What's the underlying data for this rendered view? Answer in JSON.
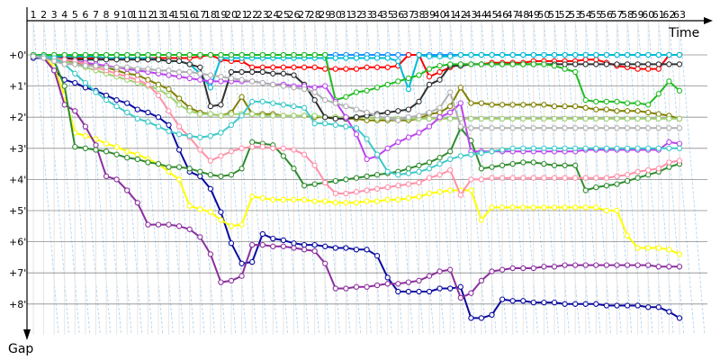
{
  "chart_data": {
    "type": "line",
    "title": "",
    "xlabel": "Time",
    "ylabel": "Gap",
    "x_ticks": [
      "1",
      "2",
      "3",
      "4",
      "5",
      "6",
      "7",
      "8",
      "9",
      "10",
      "11",
      "12",
      "13",
      "14",
      "15",
      "16",
      "17",
      "18",
      "19",
      "20",
      "21",
      "22",
      "23",
      "24",
      "25",
      "26",
      "27",
      "28",
      "29",
      "30",
      "31",
      "32",
      "33",
      "34",
      "35",
      "36",
      "37",
      "38",
      "39",
      "40",
      "41",
      "42",
      "43",
      "44",
      "45",
      "46",
      "47",
      "48",
      "49",
      "50",
      "51",
      "52",
      "53",
      "54",
      "55",
      "56",
      "57",
      "58",
      "59",
      "60",
      "61",
      "62",
      "63"
    ],
    "y_ticks": [
      "+0'",
      "+1'",
      "+2'",
      "+3'",
      "+4'",
      "+5'",
      "+6'",
      "+7'",
      "+8'"
    ],
    "y_range_minutes": [
      0,
      8.9
    ],
    "grid": true,
    "legend": "none",
    "series": [
      {
        "color": "#1e90ff",
        "values": [
          0,
          0,
          0,
          0,
          0,
          0,
          0,
          0,
          0,
          0,
          0,
          0,
          0,
          0,
          0,
          0,
          0,
          0,
          0,
          0,
          0,
          0,
          0,
          0,
          0,
          0,
          0,
          0,
          0,
          0,
          0,
          0,
          0,
          0,
          0,
          0,
          0,
          0,
          0,
          0,
          0,
          0,
          0,
          0,
          0,
          0,
          0,
          0,
          0,
          0,
          0,
          0,
          0,
          0,
          0,
          0,
          0,
          0,
          0,
          0,
          0,
          0,
          0
        ]
      },
      {
        "color": "#ff0000",
        "values": [
          0.05,
          0.05,
          0.05,
          0.1,
          0.1,
          0.1,
          0.1,
          0.1,
          0.1,
          0.1,
          0.1,
          0.1,
          0.1,
          0.1,
          0.1,
          0.1,
          0.05,
          0,
          0.15,
          0.2,
          0.2,
          0.4,
          0.4,
          0.4,
          0.4,
          0.4,
          0.4,
          0.4,
          0.45,
          0.45,
          0.45,
          0.45,
          0.4,
          0.4,
          0.4,
          0.35,
          0,
          0,
          0.7,
          0.55,
          0.4,
          0.3,
          0.3,
          0.3,
          0.25,
          0.25,
          0.25,
          0.25,
          0.2,
          0.2,
          0.2,
          0.2,
          0.2,
          0.15,
          0.15,
          0.25,
          0.35,
          0.4,
          0.45,
          0.45,
          0.45,
          0,
          0
        ]
      },
      {
        "color": "#00bcd4",
        "values": [
          0.05,
          0.05,
          0.05,
          0.05,
          0.05,
          0.05,
          0.05,
          0.1,
          0.1,
          0.1,
          0.1,
          0.1,
          0.15,
          0.2,
          0.2,
          0.3,
          0.6,
          1.05,
          0.1,
          0.1,
          0.1,
          0.1,
          0.1,
          0.1,
          0.1,
          0.1,
          0.1,
          0.1,
          0.1,
          0.1,
          0.1,
          0.1,
          0.1,
          0.1,
          0.1,
          0.2,
          1.1,
          0,
          0.05,
          0.05,
          0.05,
          0,
          0,
          0,
          0,
          0,
          0,
          0,
          0,
          0,
          0,
          0,
          0,
          0,
          0,
          0,
          0,
          0,
          0,
          0,
          0,
          0,
          0
        ]
      },
      {
        "color": "#0a0aa0",
        "values": [
          0.1,
          0.1,
          0.5,
          0.8,
          0.9,
          1.05,
          1.15,
          1.3,
          1.45,
          1.55,
          1.75,
          1.85,
          2.0,
          2.25,
          3.05,
          3.75,
          3.9,
          4.3,
          5.05,
          6.05,
          6.7,
          6.65,
          5.75,
          5.9,
          5.95,
          6.05,
          6.1,
          6.1,
          6.15,
          6.2,
          6.2,
          6.25,
          6.25,
          6.45,
          7.15,
          7.6,
          7.6,
          7.6,
          7.6,
          7.5,
          7.5,
          7.45,
          8.45,
          8.45,
          8.35,
          7.85,
          7.9,
          7.9,
          7.95,
          7.95,
          7.95,
          8.0,
          8.0,
          8.0,
          8.0,
          8.05,
          8.05,
          8.05,
          8.05,
          8.1,
          8.1,
          8.25,
          8.45
        ]
      },
      {
        "color": "#808000",
        "values": [
          0.05,
          0.05,
          0.1,
          0.2,
          0.25,
          0.3,
          0.35,
          0.4,
          0.5,
          0.6,
          0.65,
          0.8,
          0.95,
          1.1,
          1.4,
          1.7,
          1.85,
          1.9,
          1.95,
          1.85,
          1.35,
          1.9,
          1.9,
          1.9,
          1.95,
          1.95,
          1.95,
          2.0,
          2.0,
          2.0,
          2.05,
          2.05,
          2.1,
          2.1,
          2.1,
          2.1,
          2.1,
          2.05,
          1.9,
          1.85,
          1.65,
          1.05,
          1.55,
          1.55,
          1.6,
          1.6,
          1.6,
          1.6,
          1.6,
          1.6,
          1.65,
          1.65,
          1.65,
          1.7,
          1.75,
          1.75,
          1.8,
          1.8,
          1.8,
          1.85,
          1.9,
          1.95,
          2.05
        ]
      },
      {
        "color": "#a0d070",
        "values": [
          0.05,
          0.05,
          0.1,
          0.2,
          0.3,
          0.4,
          0.5,
          0.6,
          0.7,
          0.8,
          0.9,
          1.0,
          1.1,
          1.3,
          1.6,
          1.8,
          1.9,
          1.9,
          1.95,
          1.9,
          1.9,
          1.9,
          1.95,
          1.95,
          1.95,
          1.95,
          1.95,
          1.95,
          2.0,
          2.0,
          2.0,
          2.0,
          2.0,
          2.05,
          2.05,
          2.05,
          2.05,
          2.05,
          2.05,
          2.05,
          2.05,
          2.05,
          2.05,
          2.05,
          2.05,
          2.05,
          2.05,
          2.05,
          2.05,
          2.05,
          2.05,
          2.05,
          2.05,
          2.05,
          2.05,
          2.05,
          2.05,
          2.05,
          2.05,
          2.05,
          2.05,
          2.05,
          2.05
        ]
      },
      {
        "color": "#303030",
        "values": [
          0.05,
          0.05,
          0.1,
          0.1,
          0.15,
          0.15,
          0.15,
          0.15,
          0.15,
          0.15,
          0.15,
          0.15,
          0.15,
          0.2,
          0.2,
          0.3,
          0.4,
          1.65,
          1.6,
          0.55,
          0.55,
          0.55,
          0.55,
          0.6,
          0.6,
          0.65,
          0.95,
          1.45,
          2.0,
          2.05,
          2.05,
          2.0,
          1.95,
          1.9,
          1.85,
          1.8,
          1.75,
          1.5,
          0.95,
          0.8,
          0.35,
          0.35,
          0.3,
          0.3,
          0.3,
          0.3,
          0.3,
          0.3,
          0.3,
          0.3,
          0.3,
          0.3,
          0.3,
          0.3,
          0.3,
          0.3,
          0.3,
          0.3,
          0.3,
          0.3,
          0.3,
          0.3,
          0.3
        ]
      },
      {
        "color": "#ffff00",
        "values": [
          0.05,
          0.05,
          0.4,
          1.3,
          2.5,
          2.6,
          2.7,
          2.85,
          2.95,
          3.1,
          3.2,
          3.35,
          3.5,
          3.75,
          4.0,
          4.85,
          4.95,
          5.05,
          5.3,
          5.5,
          5.45,
          4.55,
          4.6,
          4.65,
          4.65,
          4.65,
          4.65,
          4.7,
          4.7,
          4.75,
          4.75,
          4.75,
          4.7,
          4.7,
          4.65,
          4.65,
          4.6,
          4.55,
          4.45,
          4.4,
          4.35,
          4.35,
          4.35,
          5.3,
          4.9,
          4.9,
          4.9,
          4.9,
          4.9,
          4.9,
          4.9,
          4.9,
          4.9,
          4.9,
          4.9,
          5.0,
          5.0,
          5.8,
          6.2,
          6.2,
          6.2,
          6.25,
          6.4
        ]
      },
      {
        "color": "#8b2f9e",
        "values": [
          0.05,
          0.1,
          0.5,
          1.6,
          1.8,
          2.3,
          2.9,
          3.9,
          4.0,
          4.35,
          4.75,
          5.45,
          5.45,
          5.45,
          5.5,
          5.6,
          5.85,
          6.4,
          7.3,
          7.25,
          7.1,
          6.1,
          6.1,
          6.15,
          6.15,
          6.2,
          6.25,
          6.3,
          6.7,
          7.5,
          7.5,
          7.45,
          7.45,
          7.4,
          7.35,
          7.35,
          7.3,
          7.25,
          7.1,
          6.95,
          6.9,
          7.8,
          7.65,
          7.25,
          6.95,
          6.9,
          6.85,
          6.85,
          6.85,
          6.8,
          6.8,
          6.75,
          6.75,
          6.75,
          6.75,
          6.75,
          6.75,
          6.75,
          6.75,
          6.75,
          6.8,
          6.8,
          6.8
        ]
      },
      {
        "color": "#2e8b2e",
        "values": [
          0.05,
          0.05,
          0.2,
          1.0,
          2.95,
          3.0,
          3.05,
          3.1,
          3.2,
          3.3,
          3.35,
          3.45,
          3.5,
          3.6,
          3.6,
          3.65,
          3.75,
          3.85,
          3.9,
          3.85,
          3.65,
          2.8,
          2.85,
          2.9,
          3.25,
          3.65,
          4.2,
          4.15,
          4.1,
          4.05,
          4.0,
          3.95,
          3.9,
          3.85,
          3.8,
          3.75,
          3.65,
          3.55,
          3.45,
          3.3,
          3.1,
          2.35,
          2.75,
          3.65,
          3.6,
          3.55,
          3.5,
          3.45,
          3.45,
          3.5,
          3.55,
          3.55,
          3.55,
          4.35,
          4.25,
          4.2,
          4.15,
          4.05,
          3.95,
          3.85,
          3.75,
          3.6,
          3.5
        ]
      },
      {
        "color": "#22bb22",
        "values": [
          0,
          0,
          0,
          0,
          0,
          0,
          0,
          0,
          0,
          0,
          0,
          0,
          0,
          0,
          0,
          0,
          0,
          0,
          0,
          0,
          0,
          0,
          0,
          0,
          0,
          0,
          0,
          0,
          0,
          1.45,
          1.35,
          1.2,
          1.15,
          1.05,
          0.95,
          0.85,
          0.75,
          0.65,
          0.45,
          0.35,
          0.3,
          0.3,
          0.3,
          0.3,
          0.3,
          0.3,
          0.3,
          0.3,
          0.3,
          0.3,
          0.35,
          0.45,
          0.55,
          1.45,
          1.5,
          1.5,
          1.5,
          1.55,
          1.55,
          1.6,
          1.25,
          0.85,
          1.15
        ]
      },
      {
        "color": "#bb44ee",
        "values": [
          0.05,
          0.05,
          0.1,
          0.15,
          0.2,
          0.25,
          0.3,
          0.35,
          0.4,
          0.45,
          0.5,
          0.55,
          0.6,
          0.65,
          0.7,
          0.75,
          0.8,
          0.85,
          0.85,
          0.85,
          0.85,
          0.85,
          0.9,
          0.95,
          0.95,
          1.0,
          1.0,
          1.05,
          1.0,
          1.5,
          2.0,
          2.55,
          3.35,
          3.25,
          3.0,
          2.8,
          2.65,
          2.5,
          2.3,
          2.0,
          1.85,
          1.55,
          3.1,
          3.1,
          3.1,
          3.1,
          3.1,
          3.1,
          3.1,
          3.1,
          3.1,
          3.1,
          3.1,
          3.05,
          3.05,
          3.05,
          3.05,
          3.05,
          3.05,
          3.05,
          3.05,
          2.8,
          2.85
        ]
      },
      {
        "color": "#ff90a8",
        "values": [
          0.05,
          0.05,
          0.1,
          0.15,
          0.2,
          0.3,
          0.4,
          0.5,
          0.6,
          0.7,
          0.8,
          0.95,
          1.3,
          1.8,
          2.3,
          2.65,
          3.05,
          3.4,
          3.25,
          3.1,
          3.0,
          2.95,
          2.95,
          3.0,
          3.0,
          3.05,
          3.2,
          3.55,
          4.1,
          4.45,
          4.45,
          4.4,
          4.35,
          4.3,
          4.25,
          4.2,
          4.15,
          4.1,
          3.95,
          3.85,
          3.7,
          4.5,
          4.0,
          4.0,
          3.95,
          3.95,
          3.95,
          3.95,
          3.95,
          3.95,
          3.95,
          3.95,
          3.95,
          3.95,
          3.95,
          3.95,
          3.9,
          3.85,
          3.75,
          3.7,
          3.65,
          3.45,
          3.4
        ]
      },
      {
        "color": "#40c8c8",
        "values": [
          0.05,
          0.05,
          0.1,
          0.3,
          0.6,
          0.9,
          1.2,
          1.45,
          1.65,
          1.85,
          2.05,
          2.15,
          2.3,
          2.45,
          2.55,
          2.6,
          2.65,
          2.6,
          2.5,
          2.25,
          1.95,
          1.5,
          1.5,
          1.55,
          1.6,
          1.65,
          1.7,
          2.2,
          2.2,
          2.25,
          2.3,
          2.35,
          2.7,
          3.2,
          3.75,
          3.85,
          3.8,
          3.75,
          3.65,
          3.5,
          3.35,
          3.25,
          3.2,
          3.15,
          3.1,
          3.05,
          3.0,
          3.0,
          3.0,
          3.0,
          3.0,
          3.0,
          3.0,
          3.0,
          3.0,
          3.0,
          3.0,
          3.0,
          3.0,
          3.0,
          3.0,
          3.0,
          3.0
        ]
      },
      {
        "color": "#b0b0b0",
        "values": [
          0.05,
          0.1,
          0.2,
          0.3,
          0.3,
          0.35,
          0.35,
          0.4,
          0.4,
          0.4,
          0.45,
          0.45,
          0.5,
          0.5,
          0.55,
          0.55,
          0.6,
          0.65,
          0.7,
          0.75,
          0.8,
          0.85,
          0.9,
          0.95,
          1.0,
          1.05,
          1.1,
          1.2,
          1.45,
          1.55,
          1.65,
          1.75,
          1.85,
          1.95,
          2.05,
          2.1,
          2.0,
          1.95,
          1.85,
          1.7,
          1.2,
          2.3,
          2.35,
          2.35,
          2.35,
          2.35,
          2.35,
          2.35,
          2.35,
          2.35,
          2.35,
          2.35,
          2.35,
          2.35,
          2.35,
          2.35,
          2.35,
          2.35,
          2.35,
          2.35,
          2.35,
          2.35,
          2.35
        ]
      }
    ]
  }
}
